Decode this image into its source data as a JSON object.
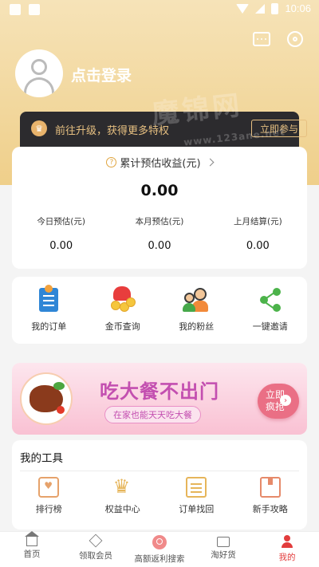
{
  "status_bar": {
    "time": "10:06"
  },
  "header": {
    "login_text": "点击登录"
  },
  "vip_bar": {
    "text": "前往升级，获得更多特权",
    "button": "立即参与"
  },
  "earnings": {
    "title": "累计预估收益(元)",
    "total": "0.00",
    "stats": [
      {
        "label": "今日预估(元)",
        "value": "0.00"
      },
      {
        "label": "本月预估(元)",
        "value": "0.00"
      },
      {
        "label": "上月结算(元)",
        "value": "0.00"
      }
    ]
  },
  "quick_actions": [
    {
      "label": "我的订单",
      "icon": "order-doc-icon"
    },
    {
      "label": "金币查询",
      "icon": "coin-bag-icon"
    },
    {
      "label": "我的粉丝",
      "icon": "fans-icon"
    },
    {
      "label": "一键邀请",
      "icon": "share-icon"
    }
  ],
  "banner": {
    "title": "吃大餐不出门",
    "subtitle": "在家也能天天吃大餐",
    "button_line1": "立即",
    "button_line2": "疯抢"
  },
  "tools": {
    "title": "我的工具",
    "items": [
      {
        "label": "排行榜",
        "icon": "ranking-icon"
      },
      {
        "label": "权益中心",
        "icon": "crown-icon"
      },
      {
        "label": "订单找回",
        "icon": "order-retrieve-icon"
      },
      {
        "label": "新手攻略",
        "icon": "guide-icon"
      }
    ]
  },
  "tabbar": [
    {
      "label": "首页",
      "icon": "home-icon"
    },
    {
      "label": "领取会员",
      "icon": "diamond-icon"
    },
    {
      "label": "高额返利搜索",
      "icon": "search-icon"
    },
    {
      "label": "淘好货",
      "icon": "folder-icon"
    },
    {
      "label": "我的",
      "icon": "profile-icon",
      "active": true
    }
  ],
  "watermark": {
    "text1": "魔锦网",
    "text2": "www.123ane.net"
  },
  "colors": {
    "gold_header": "#efcf8a",
    "vip_dark": "#2c2b2e",
    "vip_gold": "#e7c081",
    "active_red": "#e23c3c",
    "banner_pink": "#c34fb0"
  }
}
